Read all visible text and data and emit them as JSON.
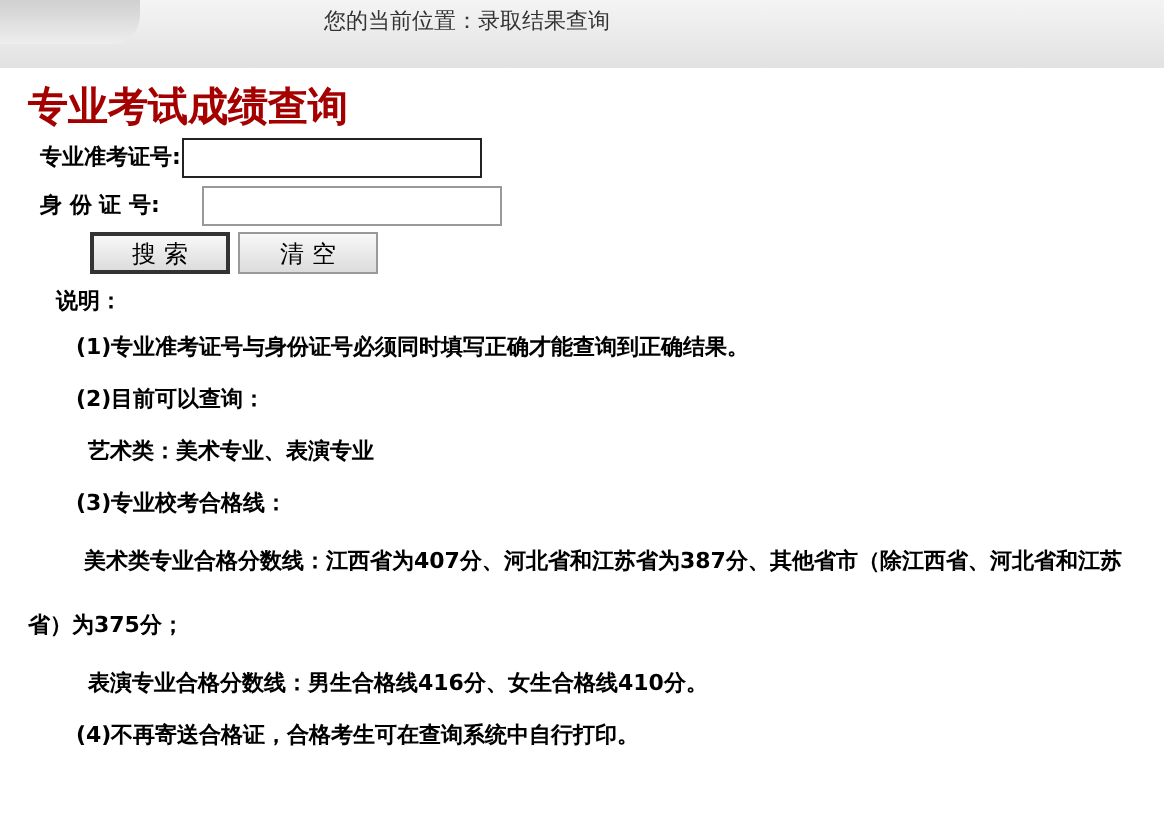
{
  "breadcrumb": "您的当前位置：录取结果查询",
  "title": "专业考试成绩查询",
  "form": {
    "fields": [
      {
        "label": "专业准考证号:",
        "focused": true
      },
      {
        "label": "身 份 证 号:",
        "focused": false
      }
    ],
    "buttons": [
      {
        "label": "搜 索",
        "kind": "primary"
      },
      {
        "label": "清 空",
        "kind": "normal"
      }
    ]
  },
  "notes_heading": "说明：",
  "notes": [
    {
      "kind": "item",
      "text": "(1)专业准考证号与身份证号必须同时填写正确才能查询到正确结果。"
    },
    {
      "kind": "item",
      "text": "(2)目前可以查询："
    },
    {
      "kind": "sub",
      "text": "艺术类：美术专业、表演专业"
    },
    {
      "kind": "item",
      "text": "(3)专业校考合格线："
    },
    {
      "kind": "wrap",
      "text": "美术类专业合格分数线：江西省为407分、河北省和江苏省为387分、其他省市（除江西省、河北省和江苏省）为375分；"
    },
    {
      "kind": "sub",
      "text": "表演专业合格分数线：男生合格线416分、女生合格线410分。"
    },
    {
      "kind": "item",
      "text": "(4)不再寄送合格证，合格考生可在查询系统中自行打印。"
    }
  ]
}
